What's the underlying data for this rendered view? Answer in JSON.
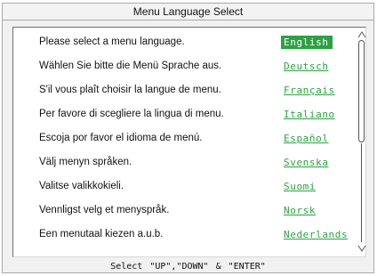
{
  "window": {
    "title": "Menu Language Select"
  },
  "languages": [
    {
      "prompt": "Please select a menu language.",
      "label": "English"
    },
    {
      "prompt": "Wählen Sie bitte die Menü Sprache aus.",
      "label": "Deutsch"
    },
    {
      "prompt": "S'il vous plaît choisir la langue de menu.",
      "label": "Français"
    },
    {
      "prompt": "Per favore di scegliere la lingua di menu.",
      "label": "Italiano"
    },
    {
      "prompt": "Escoja por favor el idioma de menú.",
      "label": "Español"
    },
    {
      "prompt": "Välj menyn språken.",
      "label": "Svenska"
    },
    {
      "prompt": "Valitse valikkokieli.",
      "label": "Suomi"
    },
    {
      "prompt": "Vennligst velg et menyspråk.",
      "label": "Norsk"
    },
    {
      "prompt": "Een menutaal kiezen a.u.b.",
      "label": "Nederlands"
    }
  ],
  "selected_index": 0,
  "footer": {
    "hint": "Select \"UP\",\"DOWN\" & \"ENTER\""
  },
  "colors": {
    "accent": "#2ea043",
    "background": "#f1f1f1",
    "list_background": "#ffffff"
  },
  "icons": {
    "scroll_up": "scroll-up-arrow-icon",
    "scroll_down": "scroll-down-arrow-icon"
  }
}
